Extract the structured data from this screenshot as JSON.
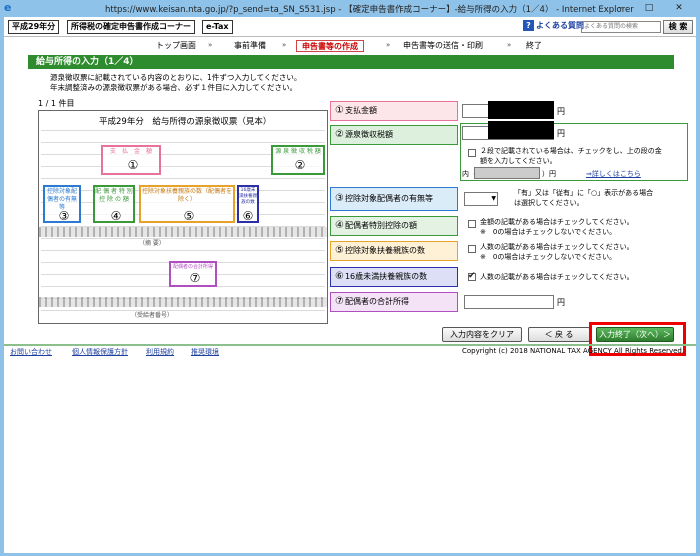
{
  "browser": {
    "title": "https://www.keisan.nta.go.jp/?p_send=ta_SN_S531.jsp - 【確定申告書作成コーナー】-給与所得の入力（1／4） - Internet Explorer",
    "minimize": "–",
    "maximize": "□",
    "close": "✕",
    "icon": "ie-icon"
  },
  "header": {
    "year_tag": "平成29年分",
    "corner_tag": "所得税の確定申告書作成コーナー",
    "etax_tag": "e-Tax",
    "faq_label": "よくある質問",
    "search_placeholder": "よくある質問の検索",
    "search_button": "検 索"
  },
  "steps": [
    {
      "label": "トップ画面"
    },
    {
      "label": "事前準備"
    },
    {
      "label": "申告書等の作成"
    },
    {
      "label": "申告書等の送信・印刷"
    },
    {
      "label": "終了"
    }
  ],
  "step_arrow": "»",
  "section": {
    "title": "給与所得の入力（1／4）",
    "intro_line1": "源泉徴収票に記載されている内容のとおりに、1件ずつ入力してください。",
    "intro_line2": "年末調整済みの源泉徴収票がある場合、必ず１件目に入力してください。",
    "count": "1 / 1 件目"
  },
  "form_image": {
    "title": "平成29年分　給与所得の源泉徴収票（見本）",
    "box1": "支　払　金　額",
    "box2": "源 泉 徴 収 税 額",
    "box3": "控除対象配偶者の有無等",
    "box4": "配 偶 者 特 別 控 除 の 額",
    "box5": "控除対象扶養親族の数（配偶者を除く）",
    "box6": "16歳未満扶養親族の数",
    "box7": "配偶者の合計所得",
    "n1": "①",
    "n2": "②",
    "n3": "③",
    "n4": "④",
    "n5": "⑤",
    "n6": "⑥",
    "n7": "⑦",
    "sub1": "（摘 要）",
    "sub2": "（受給者番号）"
  },
  "fields": [
    {
      "num": "①",
      "label": "支払金額",
      "unit": "円"
    },
    {
      "num": "②",
      "label": "源泉徴収税額",
      "unit": "円",
      "note_line1": "２段で記載されている場合は、チェックをし、上の段の金",
      "note_line2": "額を入力してください。",
      "inner_prefix": "内（",
      "inner_unit": "）円",
      "link": "⇒詳しくはこちら"
    },
    {
      "num": "③",
      "label": "控除対象配偶者の有無等",
      "note_line1": "「有」又は「従有」に「○」表示がある場合",
      "note_line2": "は選択してください。"
    },
    {
      "num": "④",
      "label": "配偶者特別控除の額",
      "note_line1": "金額の記載がある場合はチェックしてください。",
      "note_line2": "※　0の場合はチェックしないでください。"
    },
    {
      "num": "⑤",
      "label": "控除対象扶養親族の数",
      "note_line1": "人数の記載がある場合はチェックしてください。",
      "note_line2": "※　0の場合はチェックしないでください。"
    },
    {
      "num": "⑥",
      "label": "16歳未満扶養親族の数",
      "note_line1": "人数の記載がある場合はチェックしてください。",
      "checked": "✔"
    },
    {
      "num": "⑦",
      "label": "配偶者の合計所得",
      "unit": "円"
    }
  ],
  "buttons": {
    "clear": "入力内容をクリア",
    "back": "＜ 戻 る",
    "finish": "入力終了（次へ）＞"
  },
  "footer": {
    "contact": "お問い合わせ",
    "privacy": "個人情報保護方針",
    "terms": "利用規約",
    "env": "推奨環境",
    "copyright": "Copyright (c) 2018 NATIONAL TAX AGENCY All Rights Reserved."
  },
  "colors": {
    "accent_green": "#2e8b2e",
    "highlight_red": "#e00000",
    "pink": "#e8739a",
    "green": "#3a9a3a",
    "blue": "#2b7bd0",
    "orange": "#e8a22a",
    "navy": "#2b2fa8",
    "purple": "#b050c0"
  }
}
